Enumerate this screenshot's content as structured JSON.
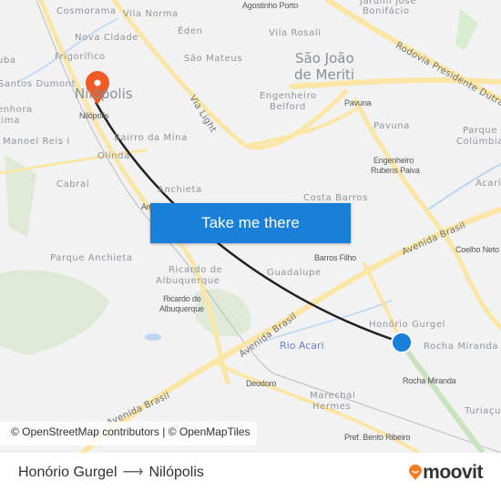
{
  "map": {
    "labels": {
      "cosmorama": "Cosmorama",
      "vila_norma": "Vila Norma",
      "nova_cidade": "Nova Cidade",
      "eden": "Éden",
      "frigorifico": "Frigorífico",
      "sao_mateus": "São Mateus",
      "santos_dumont": "Santos Dumont",
      "uba": "uba",
      "nilopolis_city": "Nilópolis",
      "enhora": "enhora",
      "tima": "tima",
      "manoel_reis": "Manoel Reis I",
      "bairro_mina": "Bairro da Mina",
      "olinda": "Olinda",
      "cabral": "Cabral",
      "anchieta": "Anchieta",
      "agostinho_porto": "Agostinho Porto",
      "jardim_jose_1": "Jardim José",
      "jardim_jose_2": "Bonifácio",
      "vila_rosali": "Vila Rosali",
      "sjm_1": "São João",
      "sjm_2": "de Meriti",
      "eng_belford_1": "Engenheiro",
      "eng_belford_2": "Belford",
      "pavuna": "Pavuna",
      "parque_colombia_1": "Parque",
      "parque_colombia_2": "Colúmbia",
      "acari": "Acari",
      "costa_barros": "Costa Barros",
      "parque_anchieta": "Parque Anchieta",
      "ricardo_1": "Ricardo de",
      "ricardo_2": "Albuquerque",
      "guadalupe": "Guadalupe",
      "honorio_gurgel": "Honório Gurgel",
      "rocha_miranda": "Rocha Miranda",
      "marechal_1": "Marechal",
      "marechal_2": "Hermes",
      "turiacu": "Turiaçu"
    },
    "stations": {
      "nilopolis": "Nilópolis",
      "pavuna": "Pavuna",
      "rubens_1": "Engenheiro",
      "rubens_2": "Rubens Paiva",
      "barros_filho": "Barros Filho",
      "coelho_neto": "Coelho Neto",
      "ricardo_1": "Ricardo de",
      "ricardo_2": "Albuquerque",
      "rocha_miranda": "Rocha Miranda",
      "deodoro": "Deodoro",
      "bento_ribeiro": "Pref. Bento Ribeiro",
      "anchieta": "Anchieta"
    },
    "roads": {
      "via_light": "Via Light",
      "dutra": "Rodovia Presidente Dutra",
      "av_brasil": "Avenida Brasil"
    },
    "river": "Rio Acari",
    "cta_label": "Take me there",
    "attribution": "© OpenStreetMap contributors | © OpenMapTiles",
    "origin_color": "#1a7fd9",
    "destination_color": "#f15a24"
  },
  "footer": {
    "origin": "Honório Gurgel",
    "destination": "Nilópolis",
    "logo": "moovit"
  }
}
